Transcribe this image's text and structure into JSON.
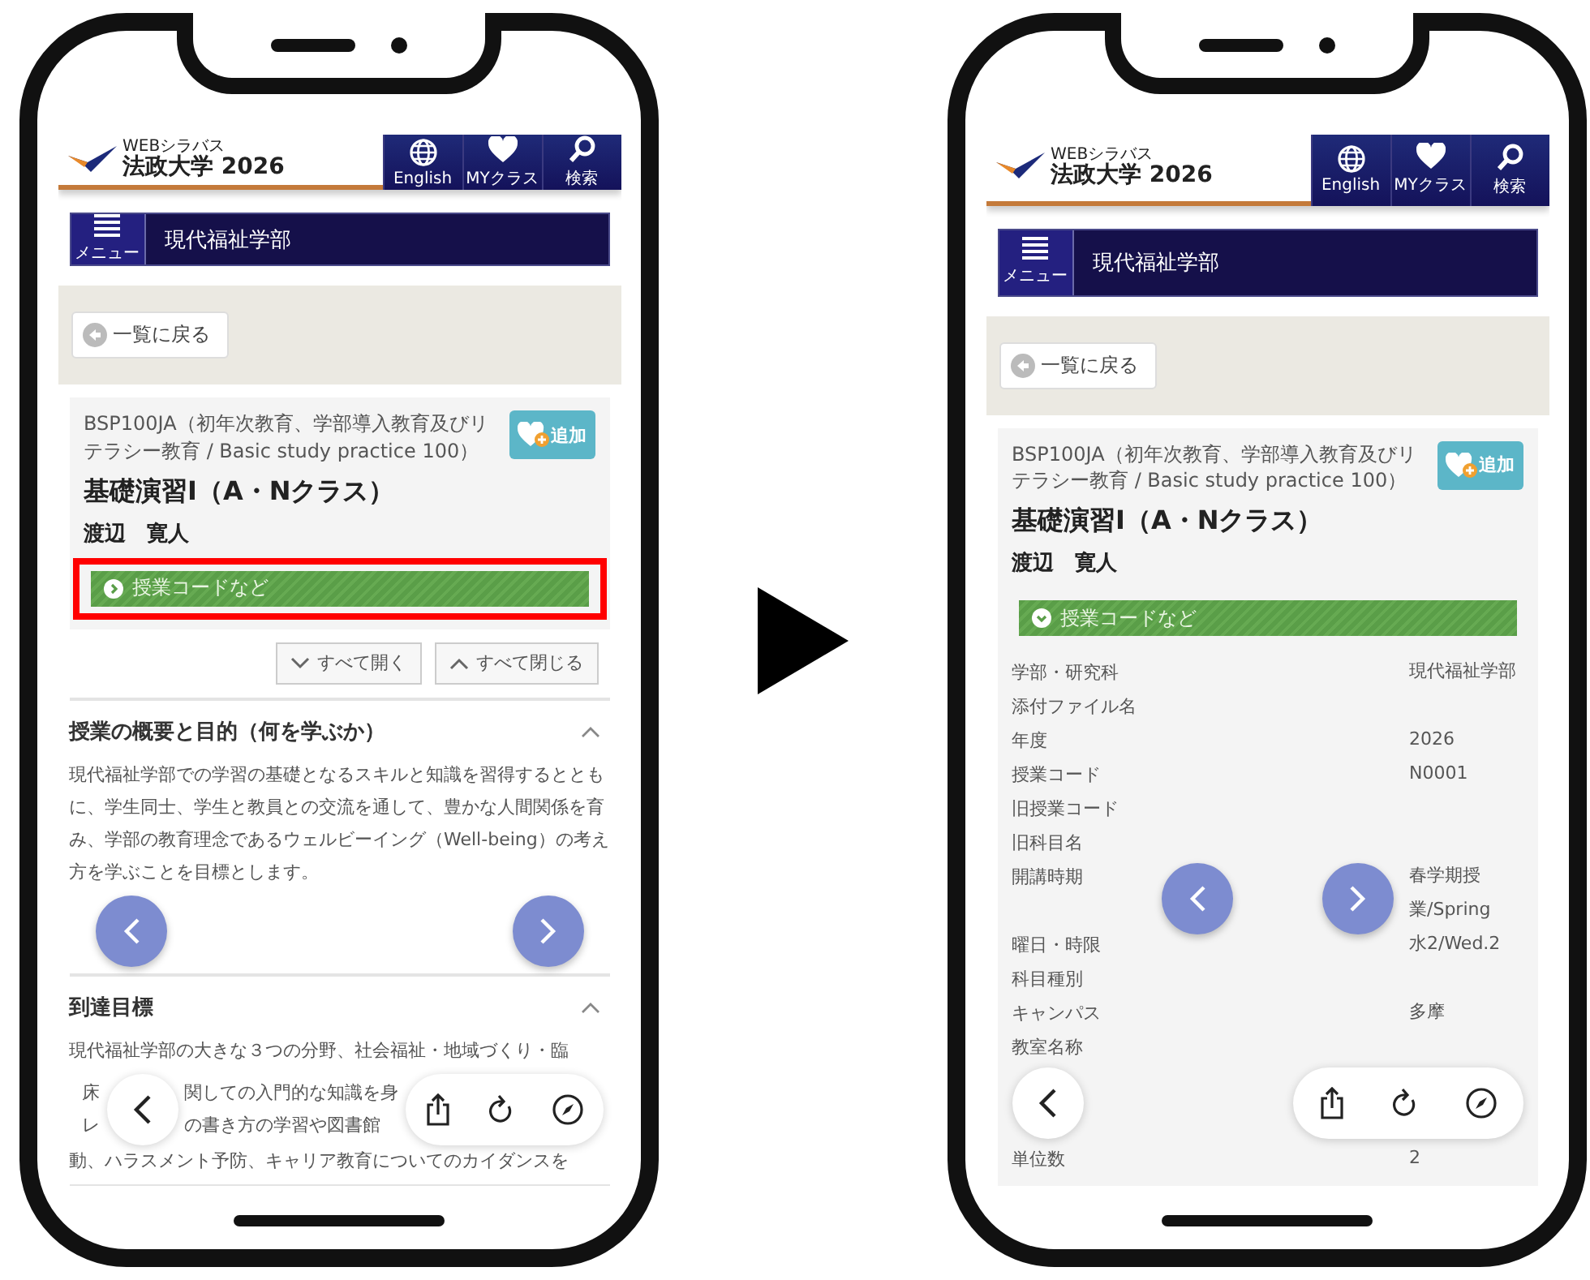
{
  "phones": [
    {
      "header": {
        "subtitle": "WEBシラバス",
        "title": "法政大学 2026",
        "nav": [
          {
            "kind": "globe",
            "label": "English"
          },
          {
            "kind": "heart",
            "label": "MYクラス"
          },
          {
            "kind": "search",
            "label": "検索"
          }
        ]
      },
      "menu": {
        "label": "メニュー",
        "title": "現代福祉学部"
      },
      "back_button": "一覧に戻る",
      "course": {
        "code_line": "BSP100JA（初年次教育、学部導入教育及びリテラシー教育 / Basic study practice 100）",
        "add_button": "追加",
        "title": "基礎演習Ⅰ（A・Nクラス）",
        "instructor": "渡辺　寛人"
      },
      "details_toggle": {
        "label": "授業コードなど",
        "expanded": false,
        "highlighted": true
      },
      "expand_buttons": [
        {
          "kind": "expand",
          "label": "すべて開く"
        },
        {
          "kind": "collapse",
          "label": "すべて閉じる"
        }
      ],
      "sections": [
        {
          "title": "授業の概要と目的（何を学ぶか）",
          "expanded": true,
          "lines_before": [
            "現代福祉学部での学習の基礎となるスキルと知識を習得するとともに、学生同士、学生と教員との交流を通して、豊かな人間関係を育み、学部の教育理念であるウェルビーイング（Well-being）の考え方を学ぶことを目標とします。"
          ]
        },
        {
          "title": "到達目標",
          "expanded": true,
          "lines_before": [
            "現代福祉学部の大きな３つの分野、社会福祉・地域づくり・臨"
          ],
          "covered_fragments": [
            "床",
            "レ"
          ],
          "covered_fragments_right": [
            "関しての入門的な知識を身",
            "の書き方の学習や図書館"
          ],
          "lines_after": [
            "動、ハラスメント予防、キャリア教育についてのカイダンスを"
          ]
        }
      ]
    },
    {
      "header": {
        "subtitle": "WEBシラバス",
        "title": "法政大学 2026",
        "nav": [
          {
            "kind": "globe",
            "label": "English"
          },
          {
            "kind": "heart",
            "label": "MYクラス"
          },
          {
            "kind": "search",
            "label": "検索"
          }
        ]
      },
      "menu": {
        "label": "メニュー",
        "title": "現代福祉学部"
      },
      "back_button": "一覧に戻る",
      "course": {
        "code_line": "BSP100JA（初年次教育、学部導入教育及びリテラシー教育 / Basic study practice 100）",
        "add_button": "追加",
        "title": "基礎演習Ⅰ（A・Nクラス）",
        "instructor": "渡辺　寛人"
      },
      "details_toggle": {
        "label": "授業コードなど",
        "expanded": true,
        "highlighted": false
      },
      "details": [
        {
          "label": "学部・研究科",
          "value": "現代福祉学部"
        },
        {
          "label": "添付ファイル名"
        },
        {
          "label": "年度",
          "value": "2026"
        },
        {
          "label": "授業コード",
          "value": "N0001"
        },
        {
          "label": "旧授業コード"
        },
        {
          "label": "旧科目名"
        },
        {
          "label": "開講時期",
          "value": "春学期授業/Spring"
        },
        {
          "label": "曜日・時限",
          "value": "水2/Wed.2"
        },
        {
          "label": "科目種別"
        },
        {
          "label": "キャンパス",
          "value": "多摩"
        },
        {
          "label": "教室名称"
        }
      ],
      "details_after": [
        {
          "label": "単位数",
          "value": "2"
        }
      ]
    }
  ]
}
